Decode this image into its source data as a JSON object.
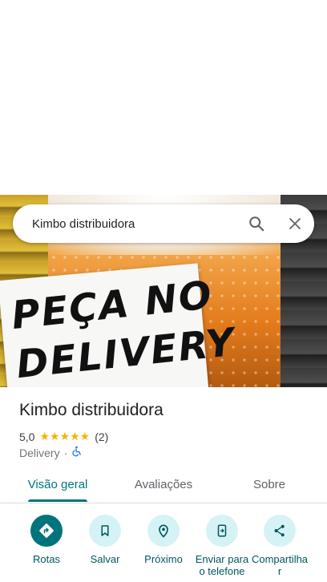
{
  "search": {
    "value": "Kimbo distribuidora",
    "placeholder": ""
  },
  "hero": {
    "line1": "PEÇA NO",
    "line2": "DELIVERY"
  },
  "place": {
    "title": "Kimbo distribuidora",
    "rating": "5,0",
    "stars": "★★★★★",
    "review_count": "(2)",
    "category": "Delivery",
    "separator": "·"
  },
  "tabs": [
    {
      "label": "Visão geral",
      "selected": true
    },
    {
      "label": "Avaliações",
      "selected": false
    },
    {
      "label": "Sobre",
      "selected": false
    }
  ],
  "actions": [
    {
      "label": "Rotas",
      "icon": "directions-icon"
    },
    {
      "label": "Salvar",
      "icon": "bookmark-icon"
    },
    {
      "label": "Próximo",
      "icon": "nearby-icon"
    },
    {
      "label": "Enviar para o telefone",
      "icon": "send-to-phone-icon"
    },
    {
      "label": "Compartilhar",
      "icon": "share-icon"
    }
  ],
  "colors": {
    "accent": "#00747c",
    "chip_bg": "#d5f3f7",
    "star": "#f4b400",
    "accessibility": "#1a73e8"
  }
}
